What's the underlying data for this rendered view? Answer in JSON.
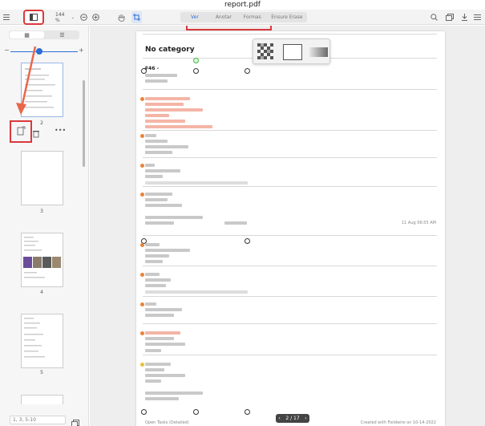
{
  "window": {
    "title": "report.pdf"
  },
  "toolbar": {
    "zoom": "144 %",
    "tabs": [
      {
        "label": "Ver"
      },
      {
        "label": "Anotar"
      },
      {
        "label": "Formas"
      },
      {
        "label": "Ensure Erase"
      }
    ]
  },
  "sidebar": {
    "page_labels": [
      "2",
      "3",
      "4",
      "5"
    ],
    "page_field_placeholder": "1, 3, 5-10"
  },
  "document": {
    "heading": "No category",
    "item_id": "#46 -",
    "timestamp": "11 Aug 06:55 AM",
    "footer_left": "Open Tasks (Detailed)",
    "footer_right": "Created with Fieldwire on 10-14-2022"
  },
  "pager": {
    "label": "2 / 17"
  },
  "colors": {
    "accent": "#2b6dd6",
    "highlight": "#d9393c",
    "orange_dot": "#e8843a",
    "yellow_dot": "#e8c23a",
    "green_handle": "#3dbb3d"
  }
}
